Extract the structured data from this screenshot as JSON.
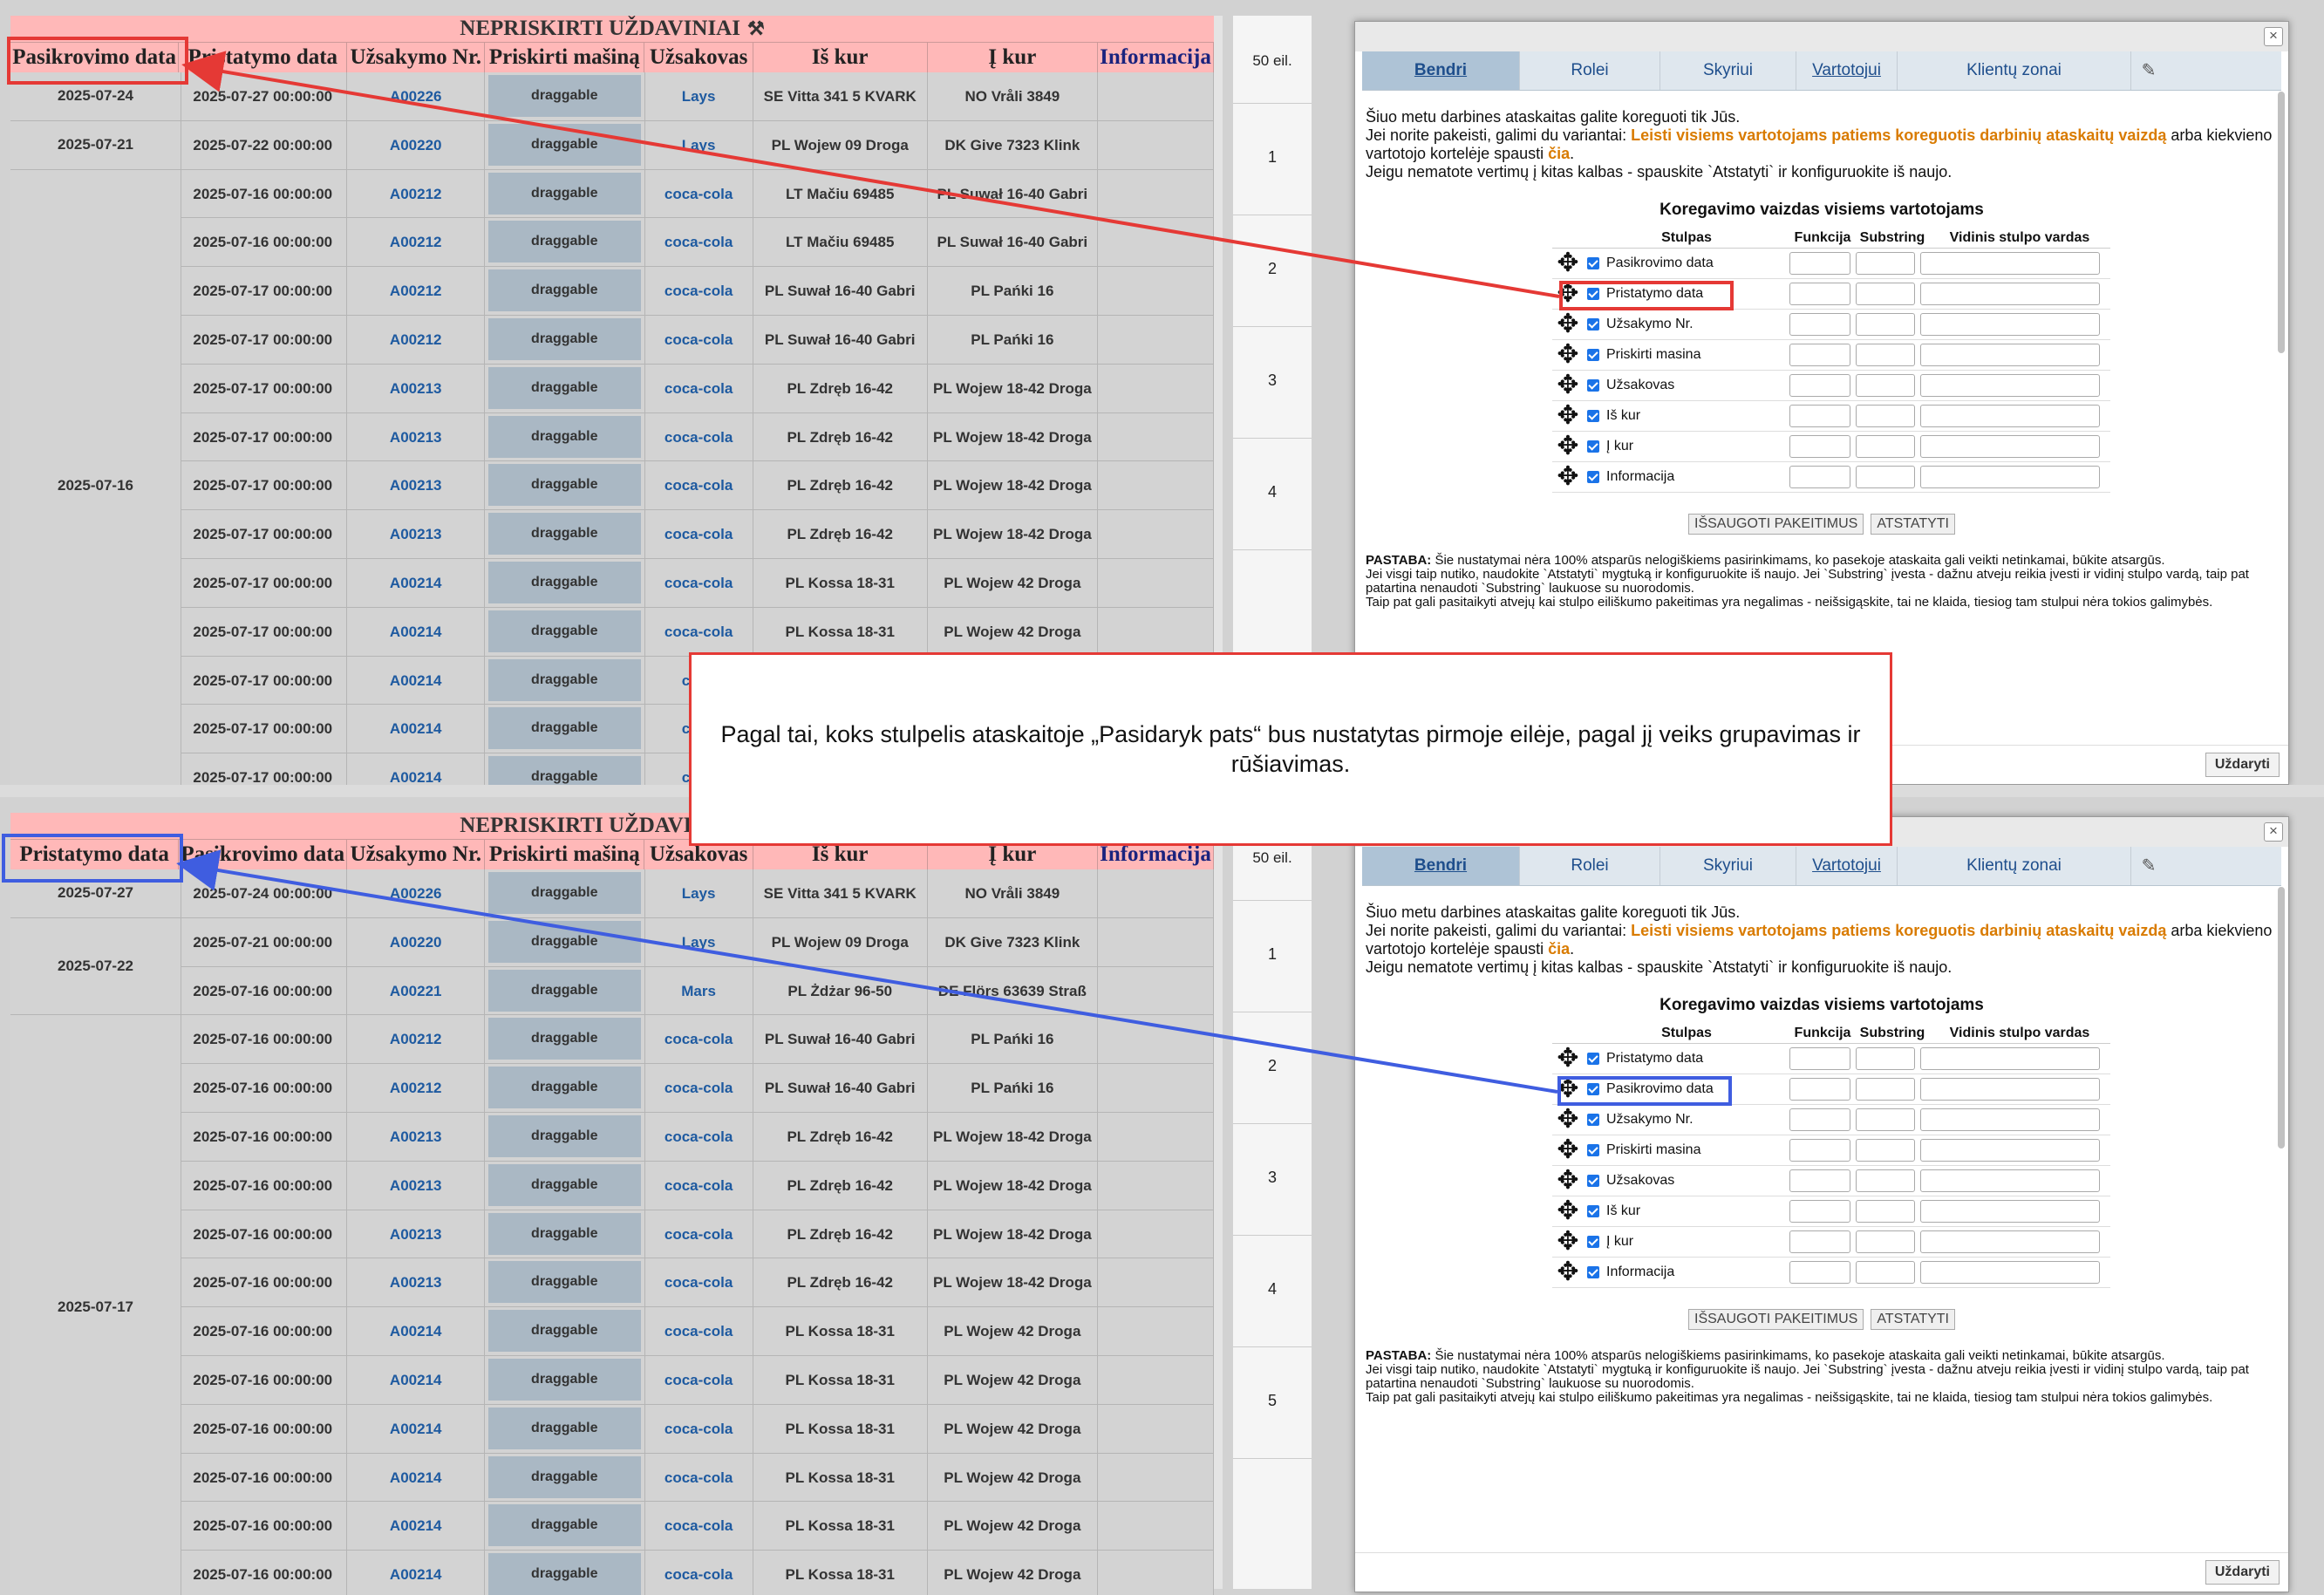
{
  "report": {
    "title": "NEPRISKIRTI UŽDAVINIAI",
    "title_icon": "tools-icon",
    "headers_top": [
      "Pasikrovimo data",
      "Pristatymo data",
      "Užsakymo Nr.",
      "Priskirti mašiną",
      "Užsakovas",
      "Iš kur",
      "Į kur",
      "Informacija"
    ],
    "headers_bottom": [
      "Pristatymo data",
      "Pasikrovimo data",
      "Užsakymo Nr.",
      "Priskirti mašiną",
      "Užsakovas",
      "Iš kur",
      "Į kur",
      "Informacija"
    ],
    "drag_label": "draggable",
    "rows_top": [
      {
        "group": "2025-07-24",
        "date": "2025-07-27 00:00:00",
        "order": "A00226",
        "client": "Lays",
        "from": "SE Vitta 341 5 KVARK",
        "to": "NO Vråli 3849"
      },
      {
        "group": "2025-07-21",
        "date": "2025-07-22 00:00:00",
        "order": "A00220",
        "client": "Lays",
        "from": "PL Wojew 09 Droga",
        "to": "DK Give 7323 Klink"
      },
      {
        "group": "2025-07-16",
        "date": "2025-07-16 00:00:00",
        "order": "A00212",
        "client": "coca-cola",
        "from": "LT Mačiu 69485",
        "to": "PL Suwał 16-40 Gabri"
      },
      {
        "group": "2025-07-16",
        "date": "2025-07-16 00:00:00",
        "order": "A00212",
        "client": "coca-cola",
        "from": "LT Mačiu 69485",
        "to": "PL Suwał 16-40 Gabri"
      },
      {
        "group": "2025-07-16",
        "date": "2025-07-17 00:00:00",
        "order": "A00212",
        "client": "coca-cola",
        "from": "PL Suwał 16-40 Gabri",
        "to": "PL Pańki 16"
      },
      {
        "group": "2025-07-16",
        "date": "2025-07-17 00:00:00",
        "order": "A00212",
        "client": "coca-cola",
        "from": "PL Suwał 16-40 Gabri",
        "to": "PL Pańki 16"
      },
      {
        "group": "2025-07-16",
        "date": "2025-07-17 00:00:00",
        "order": "A00213",
        "client": "coca-cola",
        "from": "PL Zdręb 16-42",
        "to": "PL Wojew 18-42 Droga"
      },
      {
        "group": "2025-07-16",
        "date": "2025-07-17 00:00:00",
        "order": "A00213",
        "client": "coca-cola",
        "from": "PL Zdręb 16-42",
        "to": "PL Wojew 18-42 Droga"
      },
      {
        "group": "2025-07-16",
        "date": "2025-07-17 00:00:00",
        "order": "A00213",
        "client": "coca-cola",
        "from": "PL Zdręb 16-42",
        "to": "PL Wojew 18-42 Droga"
      },
      {
        "group": "2025-07-16",
        "date": "2025-07-17 00:00:00",
        "order": "A00213",
        "client": "coca-cola",
        "from": "PL Zdręb 16-42",
        "to": "PL Wojew 18-42 Droga"
      },
      {
        "group": "2025-07-16",
        "date": "2025-07-17 00:00:00",
        "order": "A00214",
        "client": "coca-cola",
        "from": "PL Kossa 18-31",
        "to": "PL Wojew 42 Droga"
      },
      {
        "group": "2025-07-16",
        "date": "2025-07-17 00:00:00",
        "order": "A00214",
        "client": "coca-cola",
        "from": "PL Kossa 18-31",
        "to": "PL Wojew 42 Droga"
      },
      {
        "group": "2025-07-16",
        "date": "2025-07-17 00:00:00",
        "order": "A00214",
        "client": "coca",
        "from": "",
        "to": ""
      },
      {
        "group": "2025-07-16",
        "date": "2025-07-17 00:00:00",
        "order": "A00214",
        "client": "coca",
        "from": "",
        "to": ""
      },
      {
        "group": "2025-07-16",
        "date": "2025-07-17 00:00:00",
        "order": "A00214",
        "client": "coca",
        "from": "",
        "to": ""
      }
    ],
    "rows_bottom": [
      {
        "group": "2025-07-27",
        "date": "2025-07-24 00:00:00",
        "order": "A00226",
        "client": "Lays",
        "from": "SE Vitta 341 5 KVARK",
        "to": "NO Vråli 3849"
      },
      {
        "group": "2025-07-22",
        "date": "2025-07-21 00:00:00",
        "order": "A00220",
        "client": "Lays",
        "from": "PL Wojew 09 Droga",
        "to": "DK Give 7323 Klink"
      },
      {
        "group": "2025-07-22",
        "date": "2025-07-16 00:00:00",
        "order": "A00221",
        "client": "Mars",
        "from": "PL Żdżar 96-50",
        "to": "DE Flörs 63639 Straß"
      },
      {
        "group": "2025-07-17",
        "date": "2025-07-16 00:00:00",
        "order": "A00212",
        "client": "coca-cola",
        "from": "PL Suwał 16-40 Gabri",
        "to": "PL Pańki 16"
      },
      {
        "group": "2025-07-17",
        "date": "2025-07-16 00:00:00",
        "order": "A00212",
        "client": "coca-cola",
        "from": "PL Suwał 16-40 Gabri",
        "to": "PL Pańki 16"
      },
      {
        "group": "2025-07-17",
        "date": "2025-07-16 00:00:00",
        "order": "A00213",
        "client": "coca-cola",
        "from": "PL Zdręb 16-42",
        "to": "PL Wojew 18-42 Droga"
      },
      {
        "group": "2025-07-17",
        "date": "2025-07-16 00:00:00",
        "order": "A00213",
        "client": "coca-cola",
        "from": "PL Zdręb 16-42",
        "to": "PL Wojew 18-42 Droga"
      },
      {
        "group": "2025-07-17",
        "date": "2025-07-16 00:00:00",
        "order": "A00213",
        "client": "coca-cola",
        "from": "PL Zdręb 16-42",
        "to": "PL Wojew 18-42 Droga"
      },
      {
        "group": "2025-07-17",
        "date": "2025-07-16 00:00:00",
        "order": "A00213",
        "client": "coca-cola",
        "from": "PL Zdręb 16-42",
        "to": "PL Wojew 18-42 Droga"
      },
      {
        "group": "2025-07-17",
        "date": "2025-07-16 00:00:00",
        "order": "A00214",
        "client": "coca-cola",
        "from": "PL Kossa 18-31",
        "to": "PL Wojew 42 Droga"
      },
      {
        "group": "2025-07-17",
        "date": "2025-07-16 00:00:00",
        "order": "A00214",
        "client": "coca-cola",
        "from": "PL Kossa 18-31",
        "to": "PL Wojew 42 Droga"
      },
      {
        "group": "2025-07-17",
        "date": "2025-07-16 00:00:00",
        "order": "A00214",
        "client": "coca-cola",
        "from": "PL Kossa 18-31",
        "to": "PL Wojew 42 Droga"
      },
      {
        "group": "2025-07-17",
        "date": "2025-07-16 00:00:00",
        "order": "A00214",
        "client": "coca-cola",
        "from": "PL Kossa 18-31",
        "to": "PL Wojew 42 Droga"
      },
      {
        "group": "2025-07-17",
        "date": "2025-07-16 00:00:00",
        "order": "A00214",
        "client": "coca-cola",
        "from": "PL Kossa 18-31",
        "to": "PL Wojew 42 Droga"
      },
      {
        "group": "2025-07-17",
        "date": "2025-07-16 00:00:00",
        "order": "A00214",
        "client": "coca-cola",
        "from": "PL Kossa 18-31",
        "to": "PL Wojew 42 Droga"
      }
    ]
  },
  "middle": {
    "label": "50 eil.",
    "numbers_top": [
      "1",
      "2",
      "3",
      "4"
    ],
    "numbers_bottom": [
      "1",
      "2",
      "3",
      "4",
      "5"
    ]
  },
  "dialog": {
    "tabs": [
      "Bendri",
      "Rolei",
      "Skyriui",
      "Vartotojui",
      "Klientų zonai"
    ],
    "tool_icon": "pin-icon",
    "line1": "Šiuo metu darbines ataskaitas galite koreguoti tik Jūs.",
    "line2_pre": "Jei norite pakeisti, galimi du variantai: ",
    "line2_link": "Leisti visiems vartotojams patiems koreguotis darbinių ataskaitų vaizdą",
    "line2_mid": " arba kiekvieno vartotojo kortelėje spausti ",
    "line2_link2": "čia",
    "line2_end": ".",
    "line3": "Jeigu nematote vertimų į kitas kalbas - spauskite `Atstatyti` ir konfiguruokite iš naujo.",
    "config_title": "Koregavimo vaizdas visiems vartotojams",
    "config_headers": [
      "Stulpas",
      "Funkcija",
      "Substring",
      "Vidinis stulpo vardas"
    ],
    "columns_top": [
      "Pasikrovimo data",
      "Pristatymo data",
      "Užsakymo Nr.",
      "Priskirti masina",
      "Užsakovas",
      "Iš kur",
      "Į kur",
      "Informacija"
    ],
    "columns_bottom": [
      "Pristatymo data",
      "Pasikrovimo data",
      "Užsakymo Nr.",
      "Priskirti masina",
      "Užsakovas",
      "Iš kur",
      "Į kur",
      "Informacija"
    ],
    "save_button": "IŠSAUGOTI PAKEITIMUS",
    "reset_button": "ATSTATYTI",
    "note_label": "PASTABA:",
    "note_text": " Šie nustatymai nėra 100% atsparūs nelogiškiems pasirinkimams, ko pasekoje ataskaita gali veikti netinkamai, būkite atsargūs.",
    "note_line2": "Jei visgi taip nutiko, naudokite `Atstatyti` mygtuką ir konfiguruokite iš naujo. Jei `Substring` įvesta - dažnu atveju reikia įvesti ir vidinį stulpo vardą, taip pat patartina nenaudoti `Substring` laukuose su nuorodomis.",
    "note_line3": "Taip pat gali pasitaikyti atvejų kai stulpo eiliškumo pakeitimas yra negalimas - neišsigąskite, tai ne klaida, tiesiog tam stulpui nėra tokios galimybės.",
    "close_button": "Uždaryti",
    "close_icon": "close-icon"
  },
  "callout": {
    "text": "Pagal tai, koks stulpelis ataskaitoje „Pasidaryk pats“ bus nustatytas pirmoje eilėje, pagal jį veiks grupavimas ir rūšiavimas."
  },
  "colors": {
    "header_bg": "#ffb8b8",
    "highlight_red": "#e53935",
    "highlight_blue": "#3f5de0",
    "link_orange": "#d97b00",
    "tab_active": "#aec3d6"
  }
}
